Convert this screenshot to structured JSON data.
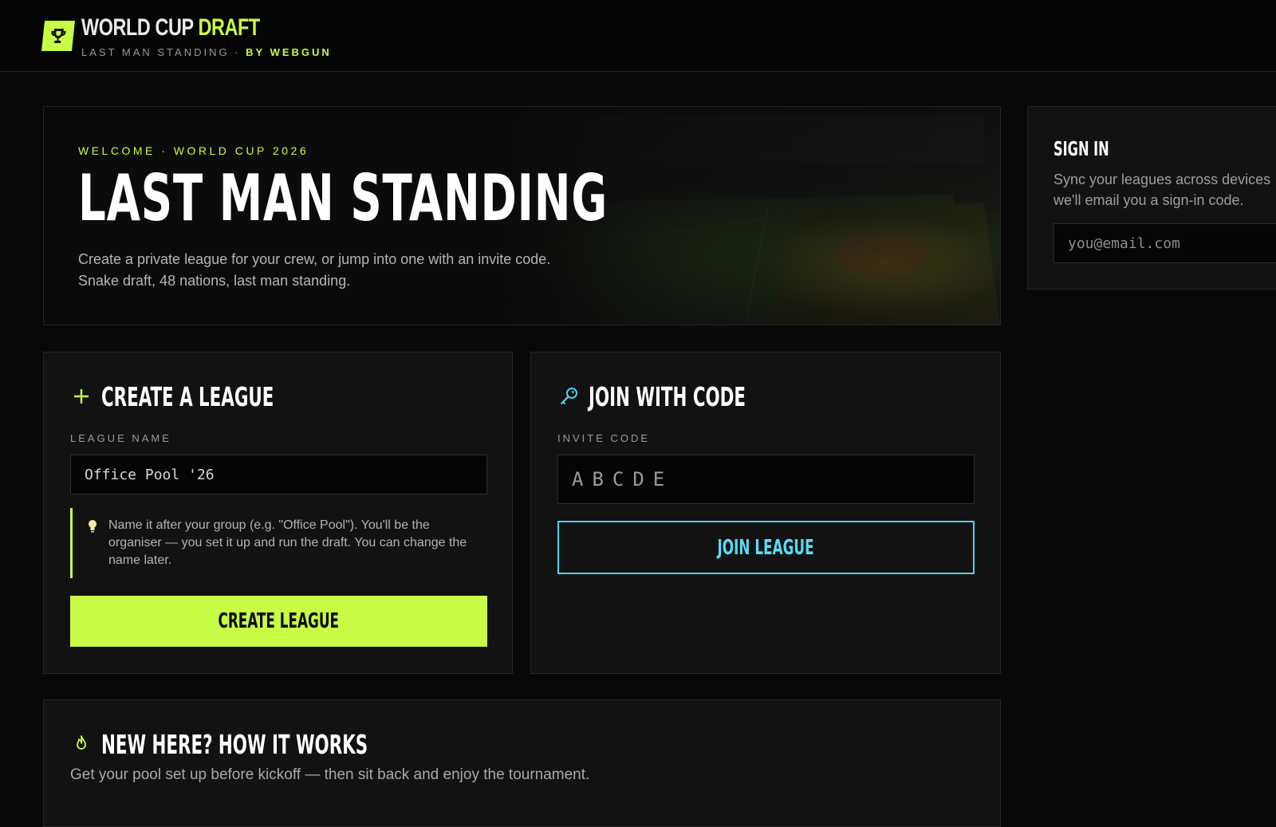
{
  "brand": {
    "title_main": "WORLD CUP",
    "title_accent": "DRAFT",
    "subtitle": "LAST MAN STANDING · ",
    "subtitle_by": "BY WEBGUN",
    "accent_color": "#c8fb45"
  },
  "hero": {
    "eyebrow": "WELCOME · WORLD CUP 2026",
    "title": "LAST MAN STANDING",
    "description": "Create a private league for your crew, or jump into one with an invite code. Snake draft, 48 nations, last man standing."
  },
  "signin": {
    "title": "SIGN IN",
    "description_line1": "Sync your leagues across devices",
    "description_line2": "we'll email you a sign-in code.",
    "email_placeholder": "you@email.com"
  },
  "create": {
    "icon": "plus-icon",
    "title": "CREATE A LEAGUE",
    "field_label": "LEAGUE NAME",
    "field_value": "Office Pool '26",
    "hint_icon": "lightbulb-icon",
    "hint": "Name it after your group (e.g. \"Office Pool\"). You'll be the organiser — you set it up and run the draft. You can change the name later.",
    "button_label": "CREATE LEAGUE"
  },
  "join": {
    "icon": "key-icon",
    "title": "JOIN WITH CODE",
    "field_label": "INVITE CODE",
    "code_placeholder": "ABCDE",
    "button_label": "JOIN LEAGUE",
    "accent_color": "#4fd3ee"
  },
  "how": {
    "icon": "flame-icon",
    "title": "NEW HERE? HOW IT WORKS",
    "subtitle": "Get your pool set up before kickoff — then sit back and enjoy the tournament."
  }
}
